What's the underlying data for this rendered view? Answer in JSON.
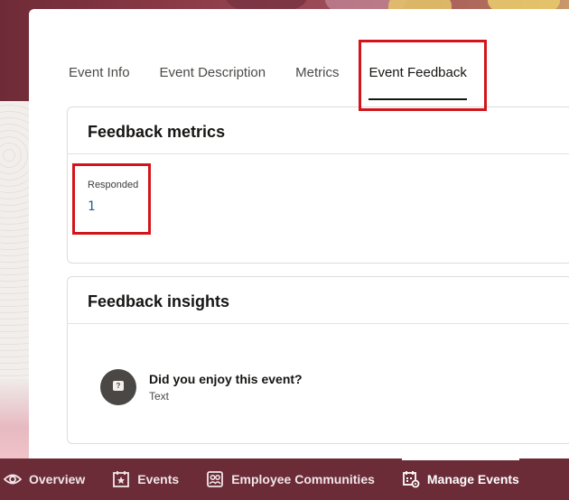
{
  "tabs": [
    {
      "label": "Event Info"
    },
    {
      "label": "Event Description"
    },
    {
      "label": "Metrics"
    },
    {
      "label": "Event Feedback"
    }
  ],
  "active_tab": "Event Feedback",
  "feedback_metrics": {
    "title": "Feedback metrics",
    "responded_label": "Responded",
    "responded_value": "1"
  },
  "feedback_insights": {
    "title": "Feedback insights",
    "question": "Did you enjoy this event?",
    "question_type": "Text"
  },
  "bottom_nav": {
    "items": [
      {
        "label": "Overview",
        "icon": "eye-icon"
      },
      {
        "label": "Events",
        "icon": "calendar-star-icon"
      },
      {
        "label": "Employee Communities",
        "icon": "people-card-icon"
      },
      {
        "label": "Manage Events",
        "icon": "calendar-gear-icon"
      }
    ],
    "active": "Manage Events"
  },
  "colors": {
    "nav_bg": "#6b2c37",
    "highlight": "#d3151b",
    "link": "#1f5f8f"
  }
}
